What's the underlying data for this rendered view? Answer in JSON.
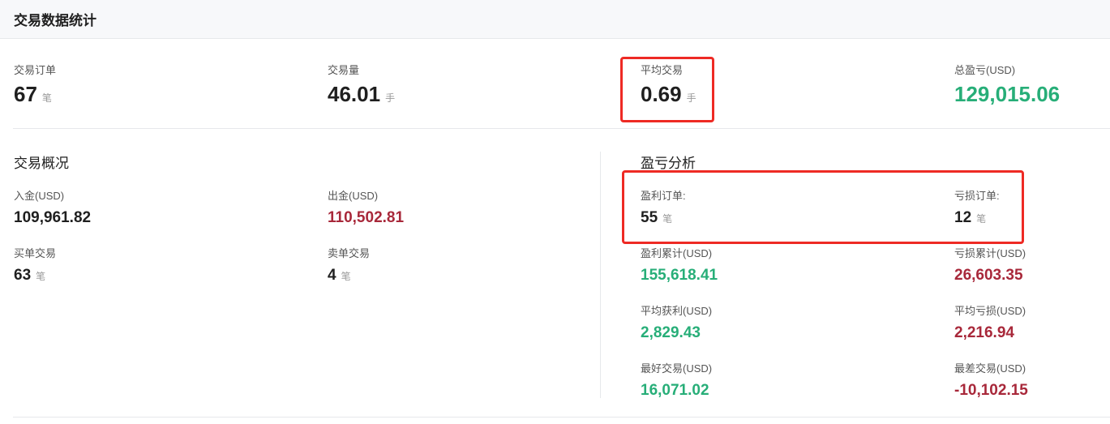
{
  "header": {
    "title": "交易数据统计"
  },
  "summary": {
    "orders": {
      "label": "交易订单",
      "value": "67",
      "unit": "笔"
    },
    "volume": {
      "label": "交易量",
      "value": "46.01",
      "unit": "手"
    },
    "avg": {
      "label": "平均交易",
      "value": "0.69",
      "unit": "手"
    },
    "pnl": {
      "label": "总盈亏(USD)",
      "value": "129,015.06"
    }
  },
  "overview": {
    "title": "交易概况",
    "deposit": {
      "label": "入金(USD)",
      "value": "109,961.82"
    },
    "withdraw": {
      "label": "出金(USD)",
      "value": "110,502.81"
    },
    "buy": {
      "label": "买单交易",
      "value": "63",
      "unit": "笔"
    },
    "sell": {
      "label": "卖单交易",
      "value": "4",
      "unit": "笔"
    }
  },
  "analysis": {
    "title": "盈亏分析",
    "profit_orders": {
      "label": "盈利订单:",
      "value": "55",
      "unit": "笔"
    },
    "loss_orders": {
      "label": "亏损订单:",
      "value": "12",
      "unit": "笔"
    },
    "profit_total": {
      "label": "盈利累计(USD)",
      "value": "155,618.41"
    },
    "loss_total": {
      "label": "亏损累计(USD)",
      "value": "26,603.35"
    },
    "avg_profit": {
      "label": "平均获利(USD)",
      "value": "2,829.43"
    },
    "avg_loss": {
      "label": "平均亏损(USD)",
      "value": "2,216.94"
    },
    "best": {
      "label": "最好交易(USD)",
      "value": "16,071.02"
    },
    "worst": {
      "label": "最差交易(USD)",
      "value": "-10,102.15"
    }
  },
  "colors": {
    "profit": "#27ae78",
    "loss": "#a8283a",
    "highlight": "#ee2a24"
  }
}
